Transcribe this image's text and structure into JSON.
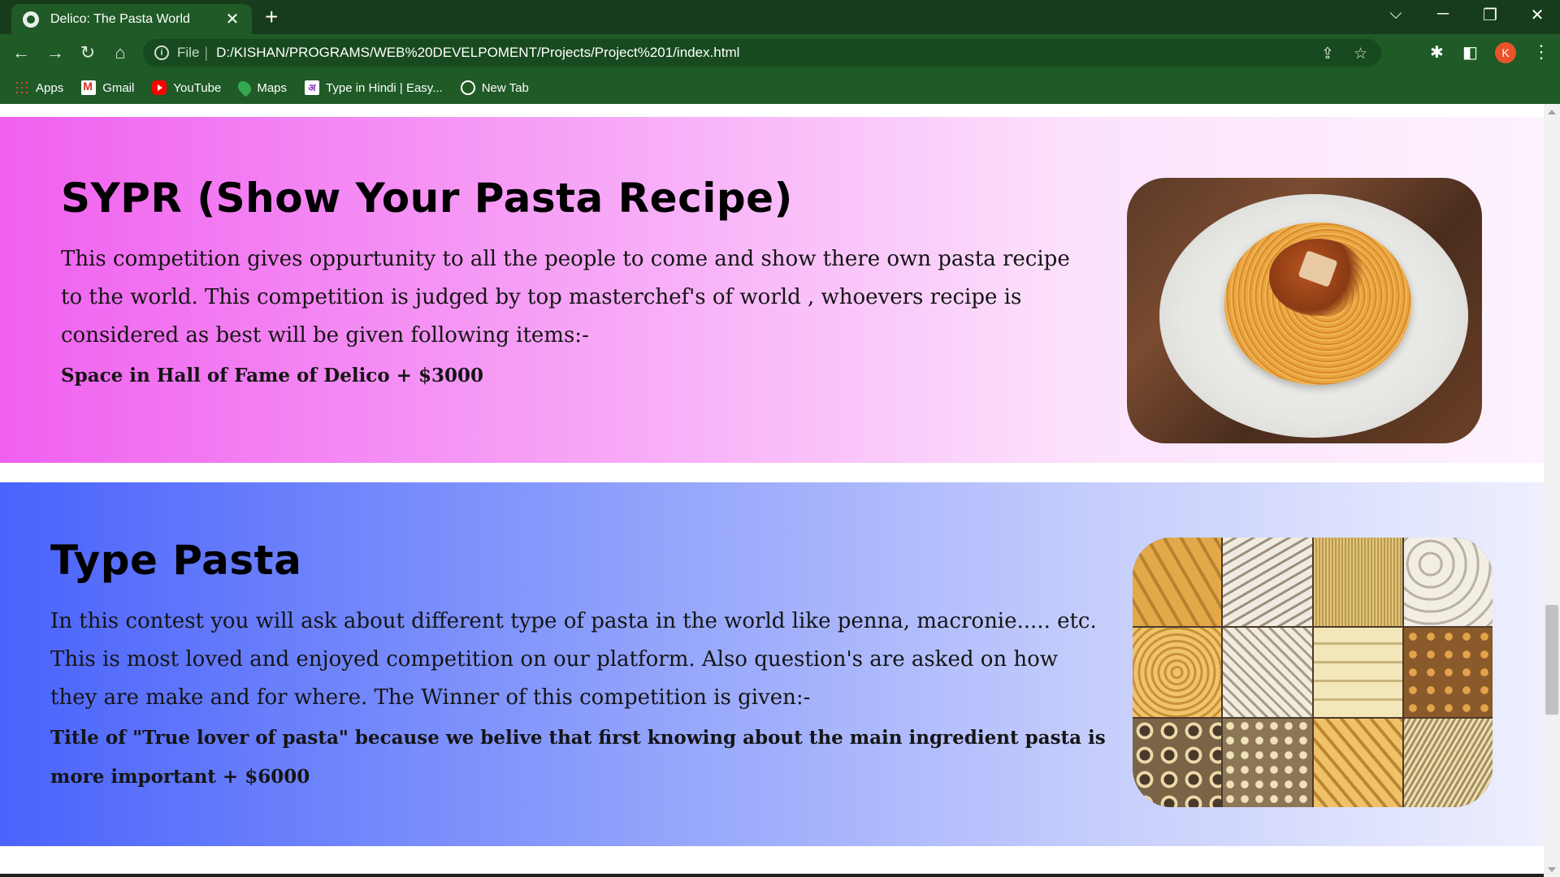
{
  "browser": {
    "tab_title": "Delico: The Pasta World",
    "tab_close": "✕",
    "new_tab": "+",
    "url_scheme": "File",
    "url_separator": "|",
    "url": "D:/KISHAN/PROGRAMS/WEB%20DEVELPOMENT/Projects/Project%201/index.html",
    "profile_initial": "K"
  },
  "bookmarks": [
    {
      "label": "Apps",
      "icon": "apps-icon"
    },
    {
      "label": "Gmail",
      "icon": "gmail-icon"
    },
    {
      "label": "YouTube",
      "icon": "youtube-icon"
    },
    {
      "label": "Maps",
      "icon": "maps-icon"
    },
    {
      "label": "Type in Hindi | Easy...",
      "icon": "hindi-icon"
    },
    {
      "label": "New Tab",
      "icon": "globe-icon"
    }
  ],
  "sections": [
    {
      "title": "SYPR (Show Your Pasta Recipe)",
      "description": "This competition gives oppurtunity to all the people to come and show there own pasta recipe to the world. This competition is judged by top masterchef's of world , whoevers recipe is considered as best will be given following items:-",
      "prize": "Space in Hall of Fame of Delico + $3000",
      "image": "spaghetti-plate-image"
    },
    {
      "title": "Type Pasta",
      "description": "In this contest you will ask about different type of pasta in the world like penna, macronie..... etc. This is most loved and enjoyed competition on our platform. Also question's are asked on how they are make and for where. The Winner of this competition is given:-",
      "prize": "Title of \"True lover of pasta\" because we belive that first knowing about the main ingredient pasta is more important + $6000",
      "image": "pasta-types-grid-image"
    }
  ],
  "colors": {
    "chrome_dark": "#173c1c",
    "chrome": "#1f5a27",
    "section1_gradient_start": "#f060ef",
    "section2_gradient_start": "#4a63fb"
  }
}
